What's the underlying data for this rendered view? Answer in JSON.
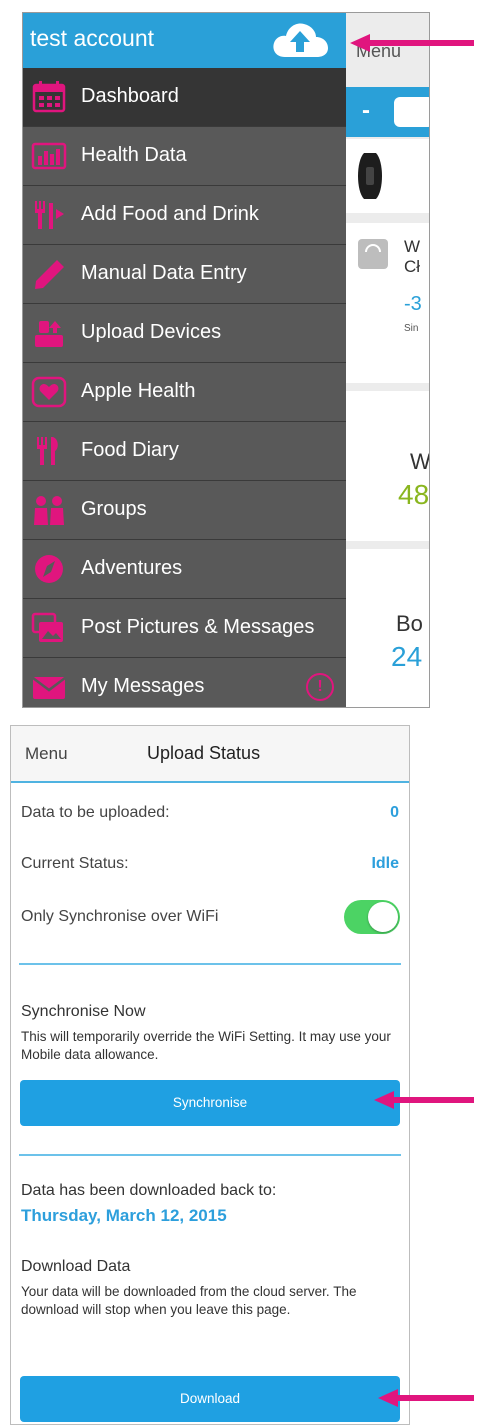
{
  "colors": {
    "accent_blue": "#2aa0d8",
    "button_blue": "#1fa0e2",
    "drawer_bg": "#595959",
    "drawer_active": "#353535",
    "icon_pink": "#e0157e",
    "toggle_green": "#4cd364",
    "arrow_pink": "#e0157e"
  },
  "drawer": {
    "account_name": "test account",
    "upload_icon": "cloud-upload-icon",
    "items": [
      {
        "label": "Dashboard",
        "icon": "calendar-icon"
      },
      {
        "label": "Health Data",
        "icon": "bar-chart-icon"
      },
      {
        "label": "Add Food and Drink",
        "icon": "cutlery-icon"
      },
      {
        "label": "Manual Data Entry",
        "icon": "pencil-icon"
      },
      {
        "label": "Upload Devices",
        "icon": "upload-device-icon"
      },
      {
        "label": "Apple Health",
        "icon": "heart-icon"
      },
      {
        "label": "Food Diary",
        "icon": "fork-knife-icon"
      },
      {
        "label": "Groups",
        "icon": "people-icon"
      },
      {
        "label": "Adventures",
        "icon": "compass-icon"
      },
      {
        "label": "Post Pictures & Messages",
        "icon": "pictures-icon"
      },
      {
        "label": "My Messages",
        "icon": "envelope-icon"
      }
    ],
    "badge": "!"
  },
  "background_screen": {
    "menu_label": "Menu",
    "minus_label": "-",
    "card_1_title": "W",
    "card_1_subtitle": "Cł",
    "card_1_value": "-3",
    "card_1_small": "Sin",
    "card_2_label": "W",
    "card_2_value": "48",
    "card_3_label": "Bo",
    "card_3_value": "24"
  },
  "upload_status": {
    "menu_label": "Menu",
    "title": "Upload Status",
    "data_to_upload_label": "Data to be uploaded:",
    "data_to_upload_value": "0",
    "current_status_label": "Current Status:",
    "current_status_value": "Idle",
    "wifi_only_label": "Only Synchronise over WiFi",
    "wifi_only_enabled": true,
    "sync_title": "Synchronise Now",
    "sync_description": "This will temporarily override the WiFi Setting.  It may use your Mobile data allowance.",
    "sync_button": "Synchronise",
    "downloaded_label": "Data has been downloaded back to:",
    "downloaded_date": "Thursday, March 12, 2015",
    "download_title": "Download Data",
    "download_description": "Your data will be downloaded from the cloud server. The download will stop when you leave this page.",
    "download_button": "Download"
  }
}
